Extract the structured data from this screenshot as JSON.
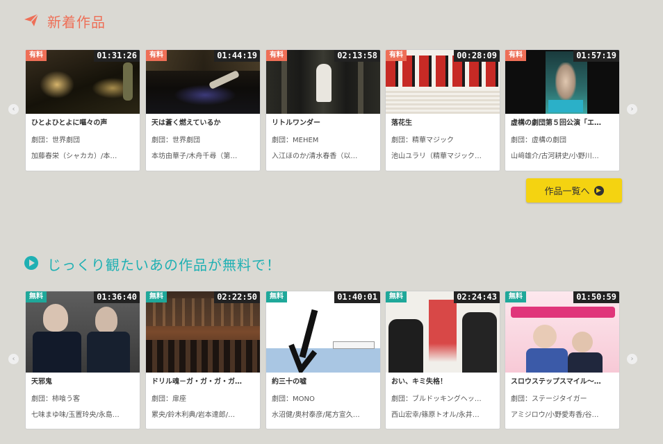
{
  "section_new": {
    "title": "新着作品",
    "icon": "paper-plane-icon",
    "accent": "#ee6f57",
    "more_label": "作品一覧へ",
    "cards": [
      {
        "badge": "有料",
        "duration": "01:31:26",
        "title": "ひとよひとよに嘔々の声",
        "troupe": "劇団：世界劇団",
        "cast": "加藤春栄（シャカカ）/本…"
      },
      {
        "badge": "有料",
        "duration": "01:44:19",
        "title": "天は蒼く燃えているか",
        "troupe": "劇団：世界劇団",
        "cast": "本坊由華子/木舟千尋（第…"
      },
      {
        "badge": "有料",
        "duration": "02:13:58",
        "title": "リトルワンダー",
        "troupe": "劇団：MEHEM",
        "cast": "入江ほのか/清水春香（以…"
      },
      {
        "badge": "有料",
        "duration": "00:28:09",
        "title": "落花生",
        "troupe": "劇団：精華マジック",
        "cast": "池山ユラリ（精華マジック…"
      },
      {
        "badge": "有料",
        "duration": "01:57:19",
        "title": "虚構の劇団第５回公演「エ…",
        "troupe": "劇団：虚構の劇団",
        "cast": "山﨑雄介/古河耕史/小野川…"
      }
    ]
  },
  "section_free": {
    "title": "じっくり観たいあの作品が無料で！",
    "icon": "play-circle-icon",
    "accent": "#1fb0b3",
    "cards": [
      {
        "badge": "無料",
        "duration": "01:36:40",
        "title": "天邪鬼",
        "troupe": "劇団：柿喰う客",
        "cast": "七味まゆ味/玉置玲央/永島…"
      },
      {
        "badge": "無料",
        "duration": "02:22:50",
        "title": "ドリル魂－ガ・ガ・ガ・ガ…",
        "troupe": "劇団：扉座",
        "cast": "累央/鈴木利典/岩本達郎/…"
      },
      {
        "badge": "無料",
        "duration": "01:40:01",
        "title": "約三十の嘘",
        "troupe": "劇団：MONO",
        "cast": "水沼健/奥村泰彦/尾方宣久…"
      },
      {
        "badge": "無料",
        "duration": "02:24:43",
        "title": "おい、キミ失格！",
        "troupe": "劇団：ブルドッキングヘッ…",
        "cast": "西山宏幸/篠原トオル/永井…"
      },
      {
        "badge": "無料",
        "duration": "01:50:59",
        "title": "スロウステップスマイル～…",
        "troupe": "劇団：ステージタイガー",
        "cast": "アミジロウ/小野愛寿香/谷…"
      }
    ]
  },
  "nav": {
    "prev_icon": "chevron-left-icon",
    "next_icon": "chevron-right-icon"
  }
}
